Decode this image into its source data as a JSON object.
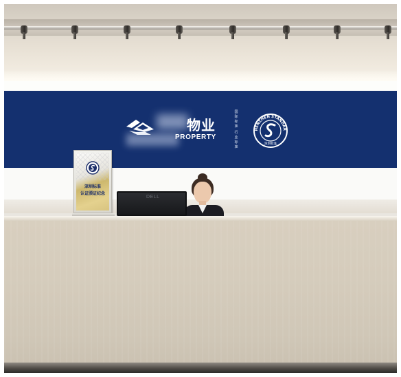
{
  "banner": {
    "brand_chinese": "物业",
    "brand_english": "PROPERTY",
    "vertical_column_1": "国际标准",
    "vertical_column_2": "行业标准",
    "seal_arc_text": "SHENZHEN STANDARD",
    "seal_bottom_text": "深圳标准",
    "background_color": "#14306f"
  },
  "sign": {
    "line_1": "深圳标准",
    "line_2": "认证颁证纪念"
  },
  "monitor": {
    "brand": "DELL"
  }
}
